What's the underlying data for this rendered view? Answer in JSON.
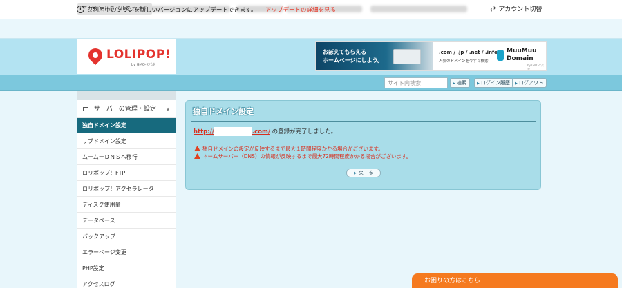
{
  "topbar": {
    "account_label_button": "アカウントラベルをつける",
    "account_switch": "アカウント切替"
  },
  "notice": {
    "text": "ご利用中のプランを新しいバージョンにアップデートできます。",
    "link": "アップデートの詳細を見る"
  },
  "logo": {
    "name": "LOLIPOP!",
    "by": "by GMOペパボ"
  },
  "banner": {
    "headline_1": "おぼえてもらえる",
    "headline_2": "ホームページにしよう。",
    "tlds": ".com / .jp / .net / .info",
    "sub": "人気のドメインを今すぐ検索",
    "brand_1": "MuuMuu",
    "brand_2": "Domain",
    "brand_by": "by GMOペパボ"
  },
  "toolbar": {
    "search_placeholder": "サイト内検索",
    "search_button": "検索",
    "login_history_button": "ログイン履歴",
    "logout_button": "ログアウト"
  },
  "sidebar": {
    "section_title": "サーバーの管理・設定",
    "items": [
      {
        "label": "独自ドメイン設定",
        "active": true
      },
      {
        "label": "サブドメイン設定",
        "active": false
      },
      {
        "label": "ムームーＤＮＳへ移行",
        "active": false
      },
      {
        "label": "ロリポップ！FTP",
        "active": false
      },
      {
        "label": "ロリポップ！アクセラレータ",
        "active": false
      },
      {
        "label": "ディスク使用量",
        "active": false
      },
      {
        "label": "データベース",
        "active": false
      },
      {
        "label": "バックアップ",
        "active": false
      },
      {
        "label": "エラーページ変更",
        "active": false
      },
      {
        "label": "PHP設定",
        "active": false
      },
      {
        "label": "アクセスログ",
        "active": false
      }
    ]
  },
  "main": {
    "title": "独自ドメイン設定",
    "domain_prefix": "http://",
    "domain_suffix": ".com/",
    "completion_text": "の登録が完了しました。",
    "warnings": [
      "独自ドメインの設定が反映するまで最大１時間程度かかる場合がございます。",
      "ネームサーバー（DNS）の情報が反映するまで最大72時間程度かかる場合がございます。"
    ],
    "back_button": "戻　る"
  },
  "help": {
    "label": "お困りの方はこちら"
  },
  "colors": {
    "brand_red": "#e4332e",
    "header_band": "#b3e3f2",
    "toolbar": "#7cc8dd",
    "sidebar_active": "#176a7e",
    "panel_bg": "#a9dde9",
    "warning_red": "#d8301f",
    "help_orange": "#f57a1f"
  },
  "icons": {
    "notice": "info-circle-icon",
    "account_switch": "swap-arrows-icon",
    "section": "server-icon",
    "section_toggle": "chevron-down-icon",
    "warning": "warning-triangle-icon"
  }
}
